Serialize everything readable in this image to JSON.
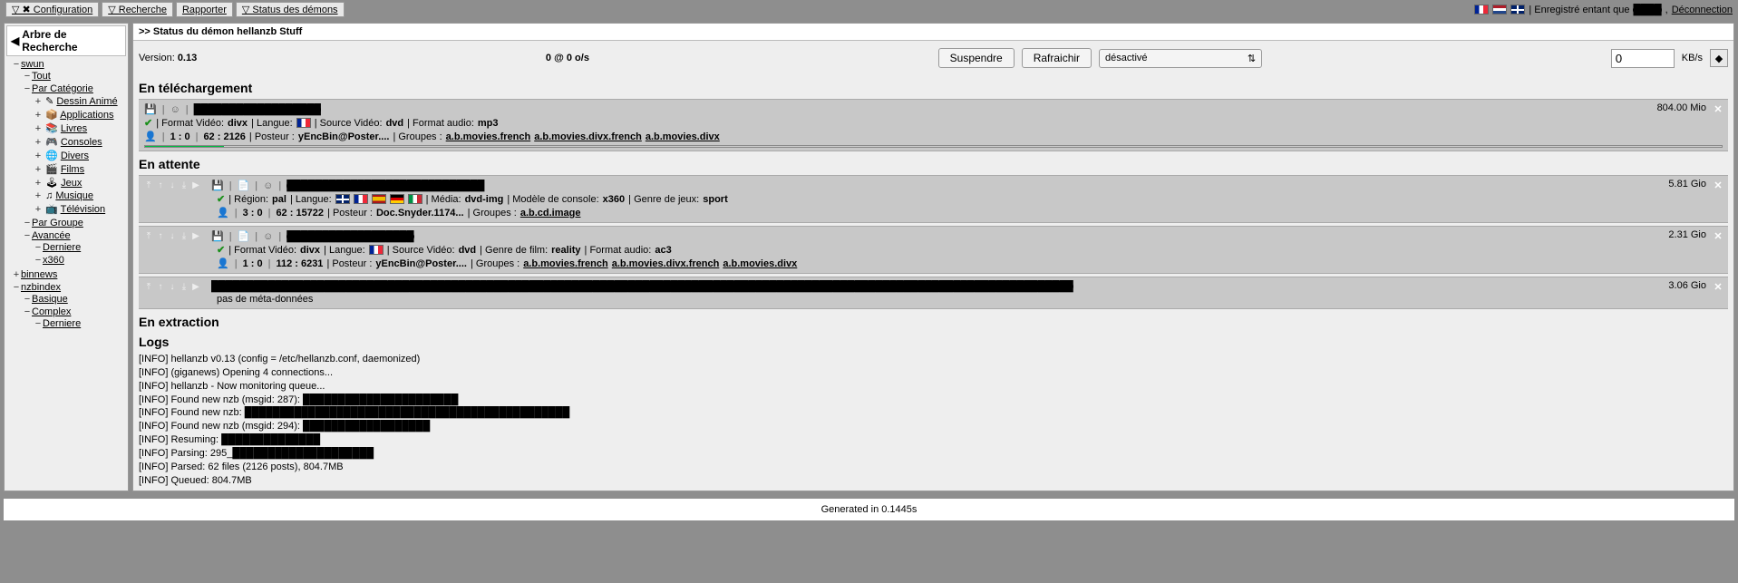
{
  "menu": {
    "config": "▽ ✖ Configuration",
    "recherche": "▽  Recherche",
    "rapporter": "Rapporter",
    "status": "▽ Status des démons"
  },
  "userbar": {
    "logged_as_prefix": "| Enregistré entant que",
    "user_redacted": "████",
    "deconnexion": "Déconnection"
  },
  "sidebar": {
    "header": "Arbre de Recherche",
    "tree": {
      "swun": "swun",
      "tout": "Tout",
      "par_categorie": "Par Catégorie",
      "cats": {
        "dessin_anime": "Dessin Animé",
        "applications": "Applications",
        "livres": "Livres",
        "consoles": "Consoles",
        "divers": "Divers",
        "films": "Films",
        "jeux": "Jeux",
        "musique": "Musique",
        "television": "Télévision"
      },
      "par_groupe": "Par Groupe",
      "avancee": "Avancée",
      "derniere": "Derniere",
      "x360": "x360",
      "binnews": "binnews",
      "nzbindex": "nzbindex",
      "basique": "Basique",
      "complex": "Complex",
      "derniere2": "Derniere"
    }
  },
  "main": {
    "header": ">> Status du démon hellanzb Stuff",
    "version_label": "Version:",
    "version": "0.13",
    "rate": "0 @ 0 o/s",
    "btn_suspend": "Suspendre",
    "btn_refresh": "Rafraichir",
    "select_value": "désactivé",
    "kbs_value": "0",
    "kbs_unit": "KB/s"
  },
  "sections": {
    "downloading": "En téléchargement",
    "queued": "En attente",
    "extracting": "En extraction",
    "logs": "Logs"
  },
  "downloading_item": {
    "size": "804.00 Mio",
    "fmt_label": "| Format Vidéo:",
    "fmt": "divx",
    "lang_label": "| Langue:",
    "src_label": "| Source Vidéo:",
    "src": "dvd",
    "aud_label": "| Format audio:",
    "aud": "mp3",
    "counts": "1 : 0",
    "posts": "62 : 2126",
    "poster_label": "| Posteur :",
    "poster": "yEncBin@Poster....",
    "groups_label": "| Groupes :",
    "g1": "a.b.movies.french",
    "g2": "a.b.movies.divx.french",
    "g3": "a.b.movies.divx"
  },
  "queue": [
    {
      "size": "5.81 Gio",
      "region_label": "| Région:",
      "region": "pal",
      "lang_label": "| Langue:",
      "media_label": "| Média:",
      "media": "dvd-img",
      "console_label": "| Modèle de console:",
      "console": "x360",
      "genre_label": "| Genre de jeux:",
      "genre": "sport",
      "counts": "3 : 0",
      "posts": "62 : 15722",
      "poster_label": "| Posteur :",
      "poster": "Doc.Snyder.1174...",
      "groups_label": "| Groupes :",
      "g1": "a.b.cd.image"
    },
    {
      "size": "2.31 Gio",
      "fmt_label": "| Format Vidéo:",
      "fmt": "divx",
      "lang_label": "| Langue:",
      "src_label": "| Source Vidéo:",
      "src": "dvd",
      "genre_label": "| Genre de film:",
      "genre": "reality",
      "aud_label": "| Format audio:",
      "aud": "ac3",
      "counts": "1 : 0",
      "posts": "112 : 6231",
      "poster_label": "| Posteur :",
      "poster": "yEncBin@Poster....",
      "groups_label": "| Groupes :",
      "g1": "a.b.movies.french",
      "g2": "a.b.movies.divx.french",
      "g3": "a.b.movies.divx"
    },
    {
      "size": "3.06 Gio",
      "no_meta": "pas de méta-données"
    }
  ],
  "logs": [
    "[INFO] hellanzb v0.13 (config = /etc/hellanzb.conf, daemonized)",
    "[INFO] (giganews) Opening 4 connections...",
    "[INFO] hellanzb - Now monitoring queue...",
    "[INFO] Found new nzb (msgid: 287): ██████████████████████",
    "[INFO] Found new nzb: ██████████████████████████████████████████████",
    "[INFO] Found new nzb (msgid: 294): ██████████████████",
    "[INFO] Resuming: ██████████████",
    "[INFO] Parsing: 295_████████████████████",
    "[INFO] Parsed: 62 files (2126 posts), 804.7MB",
    "[INFO] Queued: 804.7MB"
  ],
  "footer": "Generated in 0.1445s"
}
